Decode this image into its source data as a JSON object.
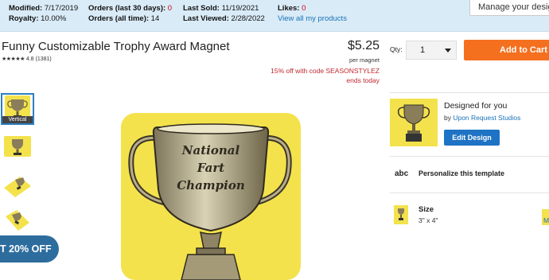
{
  "stats": {
    "modified_label": "Modified:",
    "modified": "7/17/2019",
    "royalty_label": "Royalty:",
    "royalty": "10.00%",
    "orders30_label": "Orders  (last 30 days):",
    "orders30": "0",
    "orders_all_label": "Orders  (all time):",
    "orders_all": "14",
    "last_sold_label": "Last Sold:",
    "last_sold": "11/19/2021",
    "last_viewed_label": "Last Viewed:",
    "last_viewed": "2/28/2022",
    "likes_label": "Likes:",
    "likes": "0",
    "view_all": "View all my products"
  },
  "manage_button": "Manage your design",
  "product": {
    "title": "Funny Customizable Trophy Award Magnet",
    "stars": "★★★★★",
    "rating": "4.8",
    "reviews": "(1381)",
    "price": "$5.25",
    "price_unit": "per magnet",
    "promo_line1": "15% off with code SEASONSTYLEZ",
    "promo_line2": "ends today",
    "qty_label": "Qty:",
    "qty_value": "1",
    "add_to_cart": "Add to Cart"
  },
  "thumbnails": {
    "selected_label": "Vertical"
  },
  "promo_pill": "T 20% OFF",
  "trophy_text": [
    "National",
    "Fart",
    "Champion"
  ],
  "designer": {
    "designed_for": "Designed for you",
    "by_prefix": "by ",
    "by_name": "Upon Request Studios",
    "edit_button": "Edit Design"
  },
  "personalize": {
    "icon_text": "abc",
    "label": "Personalize this template"
  },
  "size": {
    "label": "Size",
    "value": "3\" x 4\"",
    "more": "M"
  },
  "colors": {
    "topbar": "#d9ebf7",
    "cart": "#f4701f",
    "edit": "#1f73c4",
    "promo_pill": "#2d6d9e",
    "magnet_yellow": "#f3e24c",
    "red": "#d0021b"
  }
}
